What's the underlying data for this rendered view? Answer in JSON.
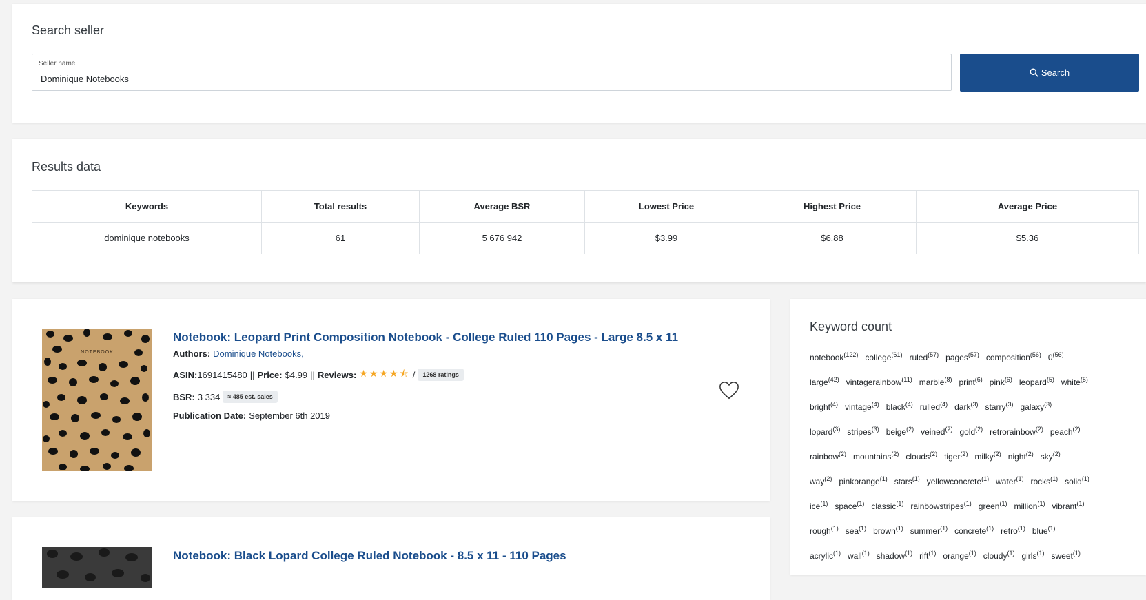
{
  "search": {
    "title": "Search seller",
    "field_label": "Seller name",
    "value": "Dominique Notebooks",
    "button_label": "Search"
  },
  "results": {
    "title": "Results data",
    "headers": [
      "Keywords",
      "Total results",
      "Average BSR",
      "Lowest Price",
      "Highest Price",
      "Average Price"
    ],
    "row": [
      "dominique notebooks",
      "61",
      "5 676 942",
      "$3.99",
      "$6.88",
      "$5.36"
    ]
  },
  "products": [
    {
      "title": "Notebook: Leopard Print Composition Notebook - College Ruled 110 Pages - Large 8.5 x 11",
      "cover_text": "NOTEBOOK",
      "authors_label": "Authors:",
      "authors": "Dominique Notebooks,",
      "asin_label": "ASIN:",
      "asin": "1691415480",
      "sep1": "||",
      "price_label": "Price:",
      "price": "$4.99",
      "sep2": "||",
      "reviews_label": "Reviews:",
      "rating": 4.5,
      "stars": "★★★★⯪",
      "rating_sep": "/",
      "ratings_count": "1268 ratings",
      "bsr_label": "BSR:",
      "bsr": "3 334",
      "est_sales": "≈ 485 est. sales",
      "pub_label": "Publication Date:",
      "pub_date": "September 6th 2019"
    },
    {
      "title": "Notebook: Black Lopard College Ruled Notebook - 8.5 x 11 - 110 Pages"
    }
  ],
  "keyword_count": {
    "title": "Keyword count",
    "rows": [
      [
        {
          "w": "notebook",
          "c": "(122)"
        },
        {
          "w": "college",
          "c": "(61)"
        },
        {
          "w": "ruled",
          "c": "(57)"
        },
        {
          "w": "pages",
          "c": "(57)"
        },
        {
          "w": "composition",
          "c": "(56)"
        },
        {
          "w": "0",
          "c": "(56)"
        }
      ],
      [
        {
          "w": "large",
          "c": "(42)"
        },
        {
          "w": "vintagerainbow",
          "c": "(11)"
        },
        {
          "w": "marble",
          "c": "(8)"
        },
        {
          "w": "print",
          "c": "(6)"
        },
        {
          "w": "pink",
          "c": "(6)"
        },
        {
          "w": "leopard",
          "c": "(5)"
        },
        {
          "w": "white",
          "c": "(5)"
        }
      ],
      [
        {
          "w": "bright",
          "c": "(4)"
        },
        {
          "w": "vintage",
          "c": "(4)"
        },
        {
          "w": "black",
          "c": "(4)"
        },
        {
          "w": "rulled",
          "c": "(4)"
        },
        {
          "w": "dark",
          "c": "(3)"
        },
        {
          "w": "starry",
          "c": "(3)"
        },
        {
          "w": "galaxy",
          "c": "(3)"
        }
      ],
      [
        {
          "w": "lopard",
          "c": "(3)"
        },
        {
          "w": "stripes",
          "c": "(3)"
        },
        {
          "w": "beige",
          "c": "(2)"
        },
        {
          "w": "veined",
          "c": "(2)"
        },
        {
          "w": "gold",
          "c": "(2)"
        },
        {
          "w": "retrorainbow",
          "c": "(2)"
        },
        {
          "w": "peach",
          "c": "(2)"
        }
      ],
      [
        {
          "w": "rainbow",
          "c": "(2)"
        },
        {
          "w": "mountains",
          "c": "(2)"
        },
        {
          "w": "clouds",
          "c": "(2)"
        },
        {
          "w": "tiger",
          "c": "(2)"
        },
        {
          "w": "milky",
          "c": "(2)"
        },
        {
          "w": "night",
          "c": "(2)"
        },
        {
          "w": "sky",
          "c": "(2)"
        }
      ],
      [
        {
          "w": "way",
          "c": "(2)"
        },
        {
          "w": "pinkorange",
          "c": "(1)"
        },
        {
          "w": "stars",
          "c": "(1)"
        },
        {
          "w": "yellowconcrete",
          "c": "(1)"
        },
        {
          "w": "water",
          "c": "(1)"
        },
        {
          "w": "rocks",
          "c": "(1)"
        },
        {
          "w": "solid",
          "c": "(1)"
        }
      ],
      [
        {
          "w": "ice",
          "c": "(1)"
        },
        {
          "w": "space",
          "c": "(1)"
        },
        {
          "w": "classic",
          "c": "(1)"
        },
        {
          "w": "rainbowstripes",
          "c": "(1)"
        },
        {
          "w": "green",
          "c": "(1)"
        },
        {
          "w": "million",
          "c": "(1)"
        },
        {
          "w": "vibrant",
          "c": "(1)"
        }
      ],
      [
        {
          "w": "rough",
          "c": "(1)"
        },
        {
          "w": "sea",
          "c": "(1)"
        },
        {
          "w": "brown",
          "c": "(1)"
        },
        {
          "w": "summer",
          "c": "(1)"
        },
        {
          "w": "concrete",
          "c": "(1)"
        },
        {
          "w": "retro",
          "c": "(1)"
        },
        {
          "w": "blue",
          "c": "(1)"
        }
      ],
      [
        {
          "w": "acrylic",
          "c": "(1)"
        },
        {
          "w": "wall",
          "c": "(1)"
        },
        {
          "w": "shadow",
          "c": "(1)"
        },
        {
          "w": "rift",
          "c": "(1)"
        },
        {
          "w": "orange",
          "c": "(1)"
        },
        {
          "w": "cloudy",
          "c": "(1)"
        },
        {
          "w": "girls",
          "c": "(1)"
        },
        {
          "w": "sweet",
          "c": "(1)"
        }
      ]
    ]
  },
  "icons": {
    "search": "search-icon",
    "heart": "heart-icon"
  },
  "colors": {
    "primary": "#1a4d8c",
    "star": "#f5a623",
    "background": "#f3f3f3"
  }
}
